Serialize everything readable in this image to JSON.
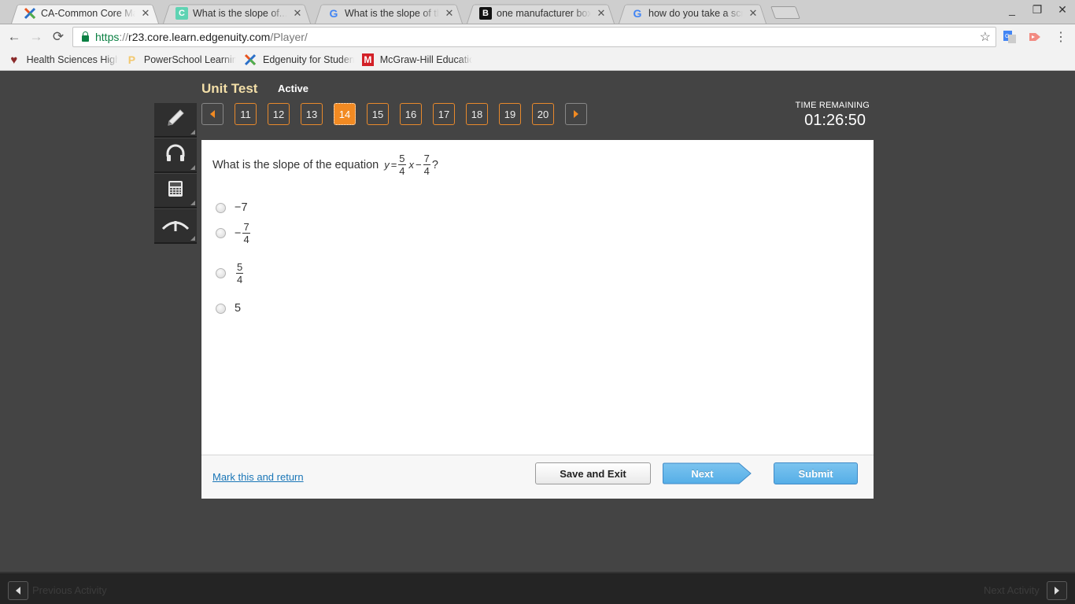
{
  "browser": {
    "tabs": [
      {
        "title": "CA-Common Core Math I",
        "icon": "edgenuity-icon",
        "active": true
      },
      {
        "title": "What is the slope of... – C",
        "icon": "chegg-icon",
        "active": false
      },
      {
        "title": "What is the slope of the e",
        "icon": "google-icon",
        "active": false
      },
      {
        "title": "one manufacturer boxes",
        "icon": "brainly-icon",
        "active": false
      },
      {
        "title": "how do you take a screen",
        "icon": "google-icon",
        "active": false
      }
    ],
    "url": {
      "scheme": "https",
      "separator": "://",
      "host": "r23.core.learn.edgenuity.com",
      "path": "/Player/"
    },
    "bookmarks": [
      {
        "title": "Health Sciences High",
        "icon": "heart-icon"
      },
      {
        "title": "PowerSchool Learning",
        "icon": "powerschool-icon"
      },
      {
        "title": "Edgenuity for Students",
        "icon": "edgenuity-icon"
      },
      {
        "title": "McGraw-Hill Education",
        "icon": "mcgraw-hill-icon"
      }
    ],
    "window_controls": {
      "minimize": "_",
      "restore": "❐",
      "close": "✕"
    }
  },
  "player": {
    "title": "Unit Test",
    "status": "Active",
    "tools": [
      {
        "name": "pencil-tool",
        "icon": "pencil-icon"
      },
      {
        "name": "audio-tool",
        "icon": "headphones-icon"
      },
      {
        "name": "calculator-tool",
        "icon": "calculator-icon"
      },
      {
        "name": "collapse-tool",
        "icon": "chevron-up-icon"
      }
    ],
    "question_nav": {
      "questions": [
        "11",
        "12",
        "13",
        "14",
        "15",
        "16",
        "17",
        "18",
        "19",
        "20"
      ],
      "current": "14"
    },
    "timer": {
      "label": "TIME REMAINING",
      "value": "01:26:50"
    },
    "question": {
      "prompt": "What is the slope of the equation",
      "equation": {
        "lhs": "y",
        "equals": "=",
        "slope_num": "5",
        "slope_den": "4",
        "variable": "x",
        "minus": "−",
        "const_num": "7",
        "const_den": "4",
        "end": "?"
      },
      "choices": [
        {
          "type": "text",
          "text": "−7"
        },
        {
          "type": "fraction",
          "sign": "−",
          "num": "7",
          "den": "4"
        },
        {
          "type": "fraction",
          "sign": "",
          "num": "5",
          "den": "4"
        },
        {
          "type": "text",
          "text": "5"
        }
      ]
    },
    "footer": {
      "mark_link": "Mark this and return",
      "save_exit": "Save and Exit",
      "next": "Next",
      "submit": "Submit"
    }
  },
  "activity_bar": {
    "previous": "Previous Activity",
    "next": "Next Activity"
  },
  "colors": {
    "accent_orange": "#f28a22",
    "title_gold": "#f3dfa8",
    "button_blue": "#5ab1e8",
    "link_blue": "#1a76b7",
    "background": "#444444"
  }
}
